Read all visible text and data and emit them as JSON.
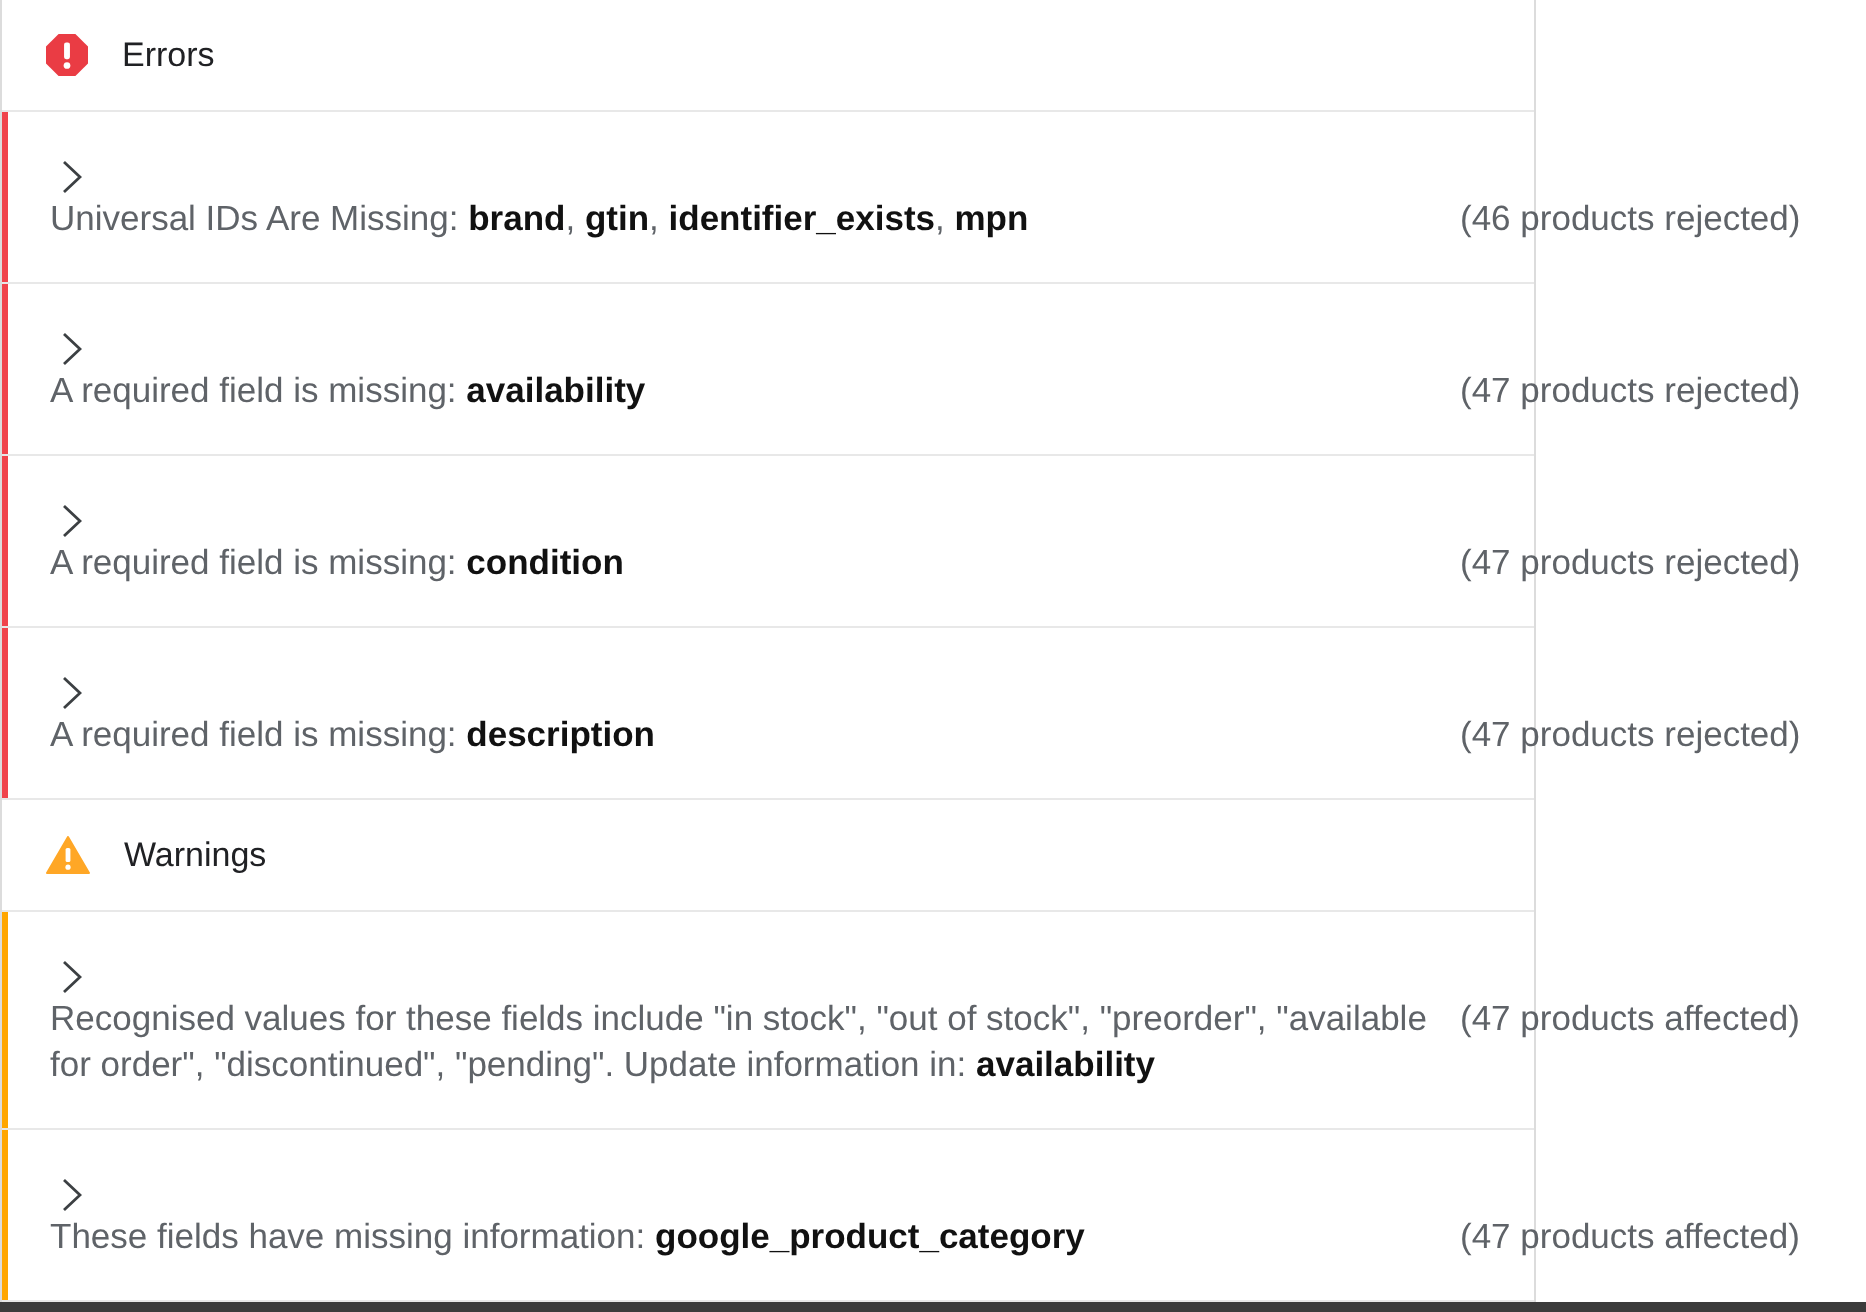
{
  "sections": [
    {
      "kind": "error",
      "title": "Errors",
      "issues": [
        {
          "expanded": false,
          "message": "Universal IDs Are Missing: **brand**, **gtin**, **identifier_exists**, **mpn**",
          "count": "(46 products rejected)"
        },
        {
          "expanded": false,
          "message": "A required field is missing: **availability**",
          "count": "(47 products rejected)"
        },
        {
          "expanded": false,
          "message": "A required field is missing: **condition**",
          "count": "(47 products rejected)"
        },
        {
          "expanded": false,
          "message": "A required field is missing: **description**",
          "count": "(47 products rejected)"
        }
      ]
    },
    {
      "kind": "warning",
      "title": "Warnings",
      "issues": [
        {
          "expanded": false,
          "message": "Recognised values for these fields include \"in stock\", \"out of stock\", \"preorder\", \"available for order\", \"discontinued\", \"pending\". Update information in: **availability**",
          "count": "(47 products affected)"
        },
        {
          "expanded": false,
          "message": "These fields have missing information: **google_product_category**",
          "count": "(47 products affected)"
        }
      ]
    }
  ]
}
